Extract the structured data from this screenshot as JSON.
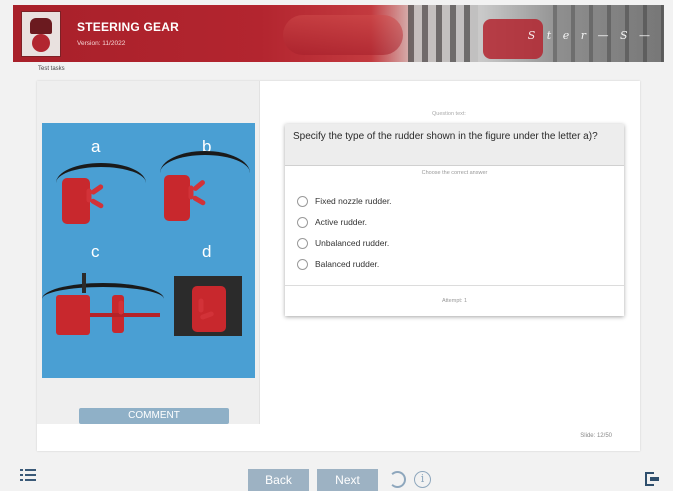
{
  "header": {
    "title": "STEERING GEAR",
    "version": "Version: 11/2022",
    "signature": "Ster— S—"
  },
  "breadcrumb": "Test tasks",
  "figure": {
    "labels": [
      "a",
      "b",
      "c",
      "d"
    ]
  },
  "comment_button": "COMMENT",
  "question": {
    "label": "Question text:",
    "text": "Specify the type of the rudder shown in the figure under the letter a)?",
    "instruction": "Choose the correct answer",
    "options": [
      "Fixed nozzle rudder.",
      "Active rudder.",
      "Unbalanced rudder.",
      "Balanced rudder."
    ],
    "selected": null,
    "attempt": "Attempt: 1"
  },
  "slide": "Slide: 12/50",
  "nav": {
    "back": "Back",
    "next": "Next"
  },
  "colors": {
    "brand_red": "#b3252f",
    "button": "#9db2c3",
    "figure_bg": "#4a9fd3"
  },
  "icons": [
    "menu-icon",
    "reload-icon",
    "info-icon",
    "exit-icon"
  ]
}
